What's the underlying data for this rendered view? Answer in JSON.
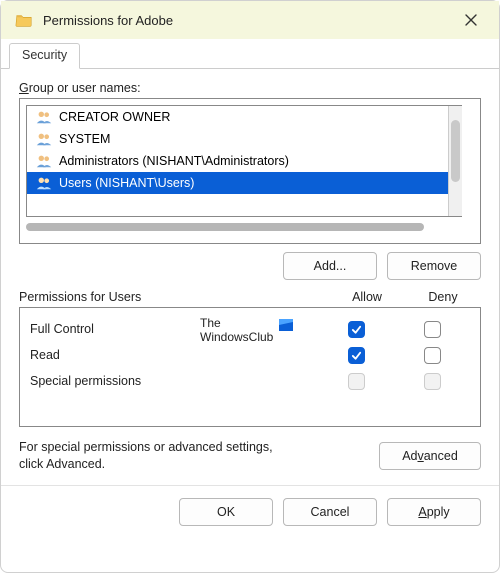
{
  "titlebar": {
    "title": "Permissions for Adobe"
  },
  "tabs": {
    "security": "Security"
  },
  "groupLabel": {
    "text_pre": "",
    "u": "G",
    "text_post": "roup or user names:"
  },
  "groups": {
    "items": [
      {
        "name": "CREATOR OWNER",
        "selected": false
      },
      {
        "name": "SYSTEM",
        "selected": false
      },
      {
        "name": "Administrators (NISHANT\\Administrators)",
        "selected": false
      },
      {
        "name": "Users (NISHANT\\Users)",
        "selected": true
      }
    ]
  },
  "buttons": {
    "add": "Add...",
    "remove": "Remove",
    "advanced": "Advanced",
    "ok": "OK",
    "cancel": "Cancel",
    "apply": "Apply"
  },
  "permHeader": {
    "title": "Permissions for Users",
    "allow": "Allow",
    "deny": "Deny"
  },
  "perms": {
    "rows": [
      {
        "name": "Full Control",
        "allow": true,
        "deny": false,
        "disabled": false
      },
      {
        "name": "Read",
        "allow": true,
        "deny": false,
        "disabled": false
      },
      {
        "name": "Special permissions",
        "allow": false,
        "deny": false,
        "disabled": true
      }
    ]
  },
  "advText": {
    "line1": "For special permissions or advanced settings,",
    "line2": "click Advanced."
  },
  "watermark": {
    "line1": "The",
    "line2": "WindowsClub"
  }
}
